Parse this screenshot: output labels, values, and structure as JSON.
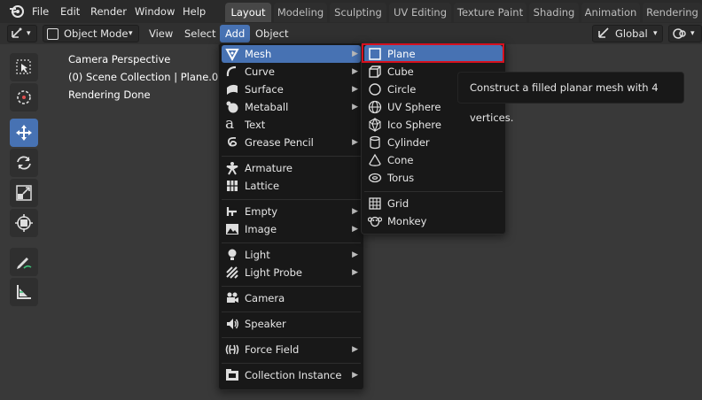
{
  "topbar": {
    "menus": [
      "File",
      "Edit",
      "Render",
      "Window",
      "Help"
    ],
    "workspaces": [
      "Layout",
      "Modeling",
      "Sculpting",
      "UV Editing",
      "Texture Paint",
      "Shading",
      "Animation",
      "Rendering"
    ]
  },
  "header": {
    "mode": "Object Mode",
    "menus": [
      "View",
      "Select",
      "Add",
      "Object"
    ],
    "orientation": "Global"
  },
  "viewport": {
    "lines": [
      "Camera Perspective",
      "(0) Scene Collection | Plane.001",
      "Rendering Done"
    ]
  },
  "add_menu": {
    "items": [
      "Mesh",
      "Curve",
      "Surface",
      "Metaball",
      "Text",
      "Grease Pencil",
      "Armature",
      "Lattice",
      "Empty",
      "Image",
      "Light",
      "Light Probe",
      "Camera",
      "Speaker",
      "Force Field",
      "Collection Instance"
    ]
  },
  "mesh_menu": {
    "items": [
      "Plane",
      "Cube",
      "Circle",
      "UV Sphere",
      "Ico Sphere",
      "Cylinder",
      "Cone",
      "Torus",
      "Grid",
      "Monkey"
    ]
  },
  "tooltip": {
    "text": "Construct a filled planar mesh with 4 vertices."
  },
  "colors": {
    "highlight": "#4772b3",
    "red_annotation": "#d6101e",
    "menu_bg": "#181818",
    "viewport_bg": "#393939"
  }
}
